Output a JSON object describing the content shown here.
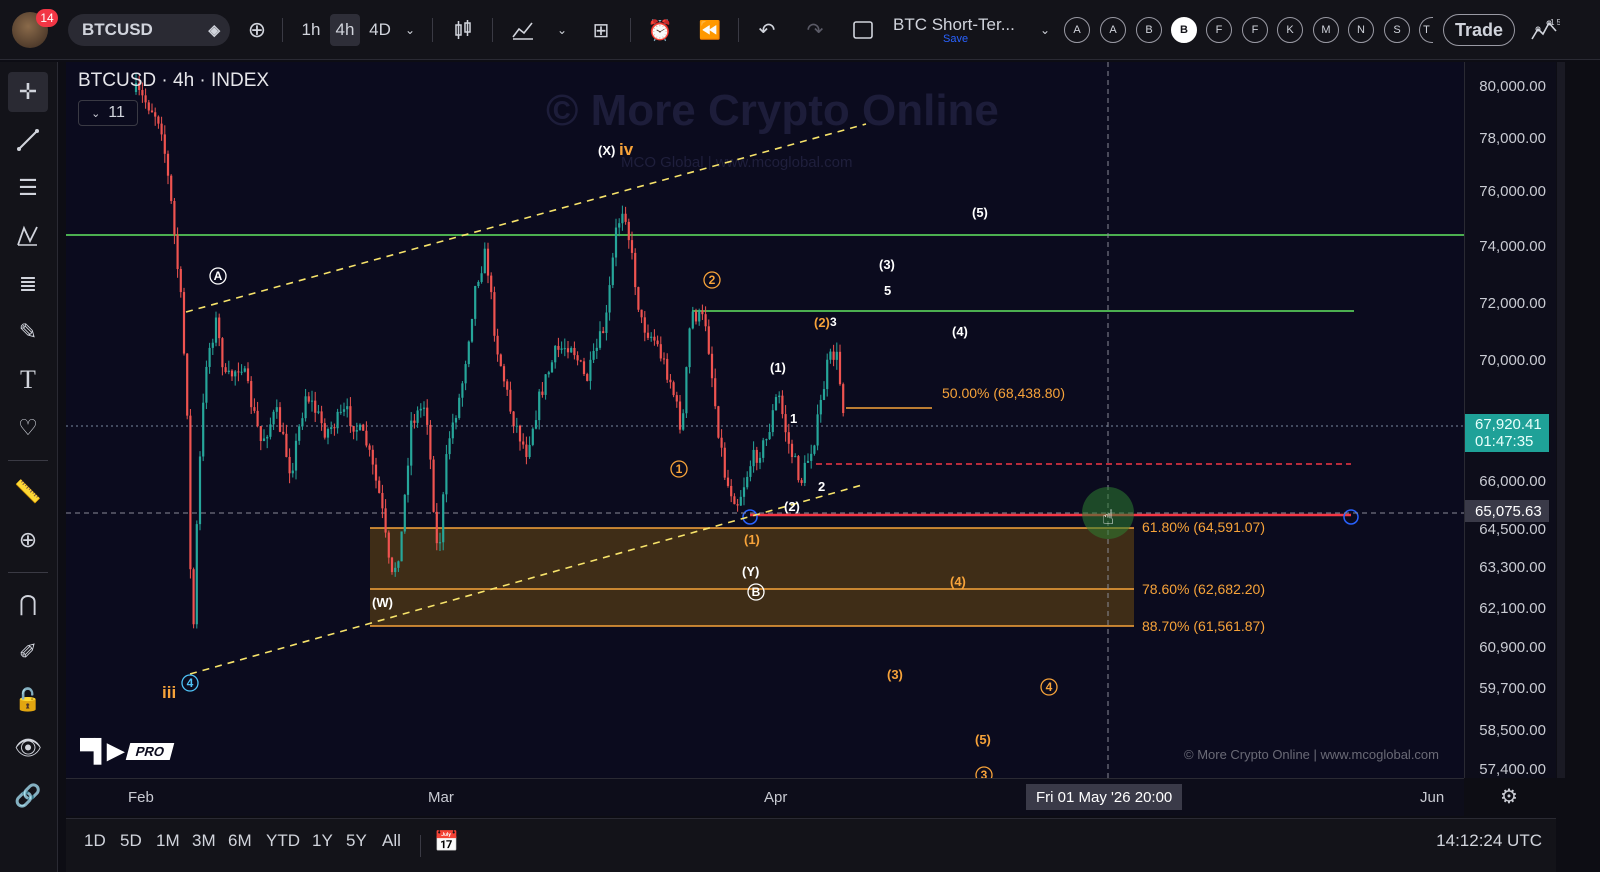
{
  "toolbar": {
    "notification_count": "14",
    "symbol": "BTCUSD",
    "timeframes": [
      "1h",
      "4h",
      "4D"
    ],
    "layout_title": "BTC Short-Ter...",
    "layout_subtitle": "Save",
    "alert_letters": [
      "A",
      "A",
      "B",
      "B",
      "F",
      "F",
      "K",
      "M",
      "N",
      "S",
      "T"
    ],
    "trade_label": "Trade"
  },
  "chart": {
    "header": "BTCUSD · 4h · INDEX",
    "indicators_count": "11",
    "watermark_title": "© More Crypto Online",
    "watermark_subtitle": "MCO Global  |  www.mcoglobal.com",
    "watermark_footer": "© More Crypto Online  |  www.mcoglobal.com",
    "tv_pro": "PRO",
    "colors": {
      "up_candle": "#26a69a",
      "down_candle": "#ef5350",
      "support_box": "#b9770e",
      "resistance_line": "#4caf50",
      "fib_text": "#f7a33a",
      "red_line": "#f23645",
      "channel": "#f7e36a"
    },
    "fib_labels": [
      "50.00% (68,438.80)",
      "61.80% (64,591.07)",
      "78.60% (62,682.20)",
      "88.70% (61,561.87)"
    ],
    "wave_labels_white": [
      "(X)",
      "(3)",
      "5",
      "(5)",
      "(4)",
      "(1)",
      "1",
      "2",
      "(2)",
      "(Y)",
      "(W)",
      "(1)"
    ],
    "wave_labels_orange": [
      "iv",
      "iii",
      "(2)",
      "3",
      "(4)",
      "(3)",
      "(5)",
      "(1)"
    ],
    "circled_labels": [
      "A",
      "B",
      "4",
      "1",
      "2",
      "4",
      "3"
    ]
  },
  "price_axis": {
    "labels": [
      "80,000.00",
      "78,000.00",
      "76,000.00",
      "74,000.00",
      "72,000.00",
      "70,000.00",
      "66,000.00",
      "64,500.00",
      "63,300.00",
      "62,100.00",
      "60,900.00",
      "59,700.00",
      "58,500.00",
      "57,400.00"
    ],
    "current_price": "67,920.41",
    "countdown": "01:47:35",
    "crosshair_price": "65,075.63"
  },
  "time_axis": {
    "labels": [
      "Feb",
      "Mar",
      "Apr",
      "Jun"
    ],
    "crosshair_time": "Fri 01 May '26   20:00"
  },
  "bottombar": {
    "ranges": [
      "1D",
      "5D",
      "1M",
      "3M",
      "6M",
      "YTD",
      "1Y",
      "5Y",
      "All"
    ],
    "clock": "14:12:24 UTC"
  }
}
